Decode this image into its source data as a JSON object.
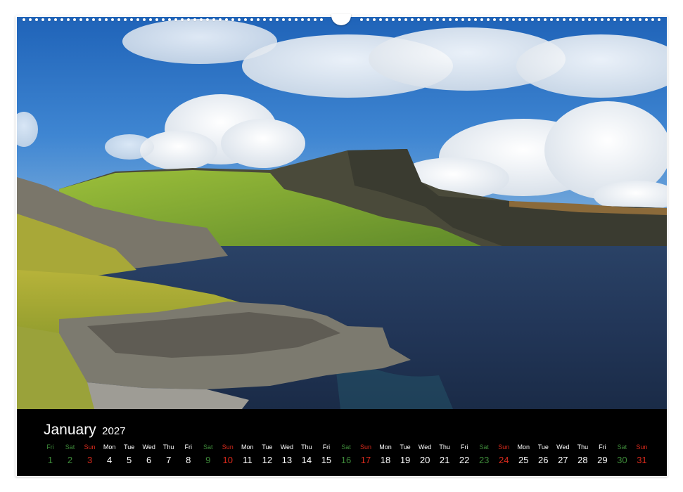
{
  "calendar": {
    "month": "January",
    "year": "2027",
    "colors": {
      "weekday": "#ffffff",
      "saturday": "#3e8a3a",
      "sunday": "#d92a1c",
      "friday_first": "#3e8a3a"
    },
    "days": [
      {
        "wd": "Fri",
        "d": "1",
        "type": "friday_first"
      },
      {
        "wd": "Sat",
        "d": "2",
        "type": "saturday"
      },
      {
        "wd": "Sun",
        "d": "3",
        "type": "sunday"
      },
      {
        "wd": "Mon",
        "d": "4",
        "type": "weekday"
      },
      {
        "wd": "Tue",
        "d": "5",
        "type": "weekday"
      },
      {
        "wd": "Wed",
        "d": "6",
        "type": "weekday"
      },
      {
        "wd": "Thu",
        "d": "7",
        "type": "weekday"
      },
      {
        "wd": "Fri",
        "d": "8",
        "type": "weekday"
      },
      {
        "wd": "Sat",
        "d": "9",
        "type": "saturday"
      },
      {
        "wd": "Sun",
        "d": "10",
        "type": "sunday"
      },
      {
        "wd": "Mon",
        "d": "11",
        "type": "weekday"
      },
      {
        "wd": "Tue",
        "d": "12",
        "type": "weekday"
      },
      {
        "wd": "Wed",
        "d": "13",
        "type": "weekday"
      },
      {
        "wd": "Thu",
        "d": "14",
        "type": "weekday"
      },
      {
        "wd": "Fri",
        "d": "15",
        "type": "weekday"
      },
      {
        "wd": "Sat",
        "d": "16",
        "type": "saturday"
      },
      {
        "wd": "Sun",
        "d": "17",
        "type": "sunday"
      },
      {
        "wd": "Mon",
        "d": "18",
        "type": "weekday"
      },
      {
        "wd": "Tue",
        "d": "19",
        "type": "weekday"
      },
      {
        "wd": "Wed",
        "d": "20",
        "type": "weekday"
      },
      {
        "wd": "Thu",
        "d": "21",
        "type": "weekday"
      },
      {
        "wd": "Fri",
        "d": "22",
        "type": "weekday"
      },
      {
        "wd": "Sat",
        "d": "23",
        "type": "saturday"
      },
      {
        "wd": "Sun",
        "d": "24",
        "type": "sunday"
      },
      {
        "wd": "Mon",
        "d": "25",
        "type": "weekday"
      },
      {
        "wd": "Tue",
        "d": "26",
        "type": "weekday"
      },
      {
        "wd": "Wed",
        "d": "27",
        "type": "weekday"
      },
      {
        "wd": "Thu",
        "d": "28",
        "type": "weekday"
      },
      {
        "wd": "Fri",
        "d": "29",
        "type": "weekday"
      },
      {
        "wd": "Sat",
        "d": "30",
        "type": "saturday"
      },
      {
        "wd": "Sun",
        "d": "31",
        "type": "sunday"
      }
    ]
  },
  "photo": {
    "subject": "coastal-cliffs-landscape"
  }
}
